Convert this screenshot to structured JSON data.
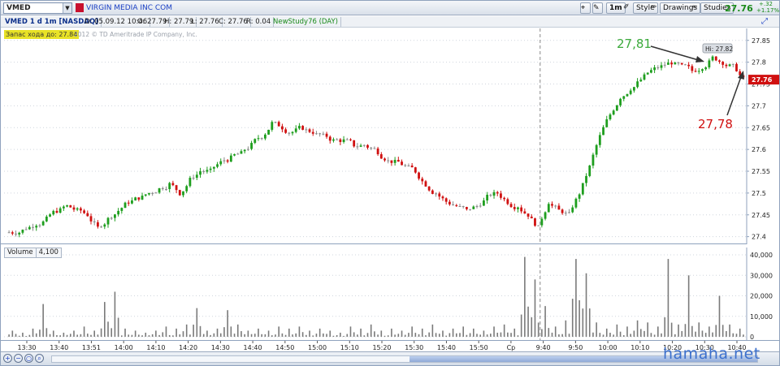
{
  "toolbar": {
    "symbol": "VMED",
    "company_name": "VIRGIN MEDIA INC COM",
    "timeframe": "1m",
    "style_label": "Style",
    "drawings_label": "Drawings",
    "studies_label": "Studies",
    "last_price": "27.76",
    "change_top": "+.32",
    "change_bottom": "+1.17%",
    "flag_color": "#c8102e"
  },
  "infobar": {
    "title": "VMED 1 d 1m [NASDAQ]",
    "date": "D: 05.09.12 10:46",
    "open": "O: 27.79",
    "high": "H: 27.79",
    "low": "L: 27.76",
    "close": "C: 27.76",
    "range": "R: 0.04",
    "study": "NewStudy76 (DAY)"
  },
  "price_pane": {
    "note": "Запас хода до: 27.84",
    "copyright": "2012 © TD Ameritrade IP Company, Inc.",
    "hi_label": "Hi: 27.82",
    "price_marker": "27.76",
    "annotation_high": "27,81",
    "annotation_low": "27,78",
    "colors": {
      "up": "#1e9e1e",
      "down": "#d01010",
      "doji": "#8a8a8a",
      "annotation_high": "#3caa3c",
      "annotation_low": "#d01010"
    }
  },
  "volume_pane": {
    "title": "Volume",
    "value": "4,100"
  },
  "time_axis": {
    "labels": [
      "13:30",
      "13:40",
      "13:51",
      "14:00",
      "14:10",
      "14:20",
      "14:30",
      "14:40",
      "14:50",
      "15:00",
      "15:10",
      "15:20",
      "15:30",
      "15:40",
      "15:50",
      "Ср",
      "9:40",
      "9:50",
      "10:00",
      "10:10",
      "10:20",
      "10:30",
      "10:40"
    ]
  },
  "watermark": "hamaha.net",
  "chart_data": {
    "type": "candlestick",
    "price_axis_ticks": [
      "27.85",
      "27.8",
      "27.75",
      "27.7",
      "27.65",
      "27.6",
      "27.55",
      "27.5",
      "27.45",
      "27.4"
    ],
    "price_ylim": [
      27.39,
      27.87
    ],
    "volume_axis_ticks": [
      "40,000",
      "30,000",
      "20,000",
      "10,000",
      "0"
    ],
    "volume_ylim": [
      0,
      42000
    ],
    "session_break": "Ср",
    "price_path": [
      27.41,
      27.42,
      27.43,
      27.44,
      27.46,
      27.47,
      27.46,
      27.45,
      27.42,
      27.44,
      27.46,
      27.48,
      27.49,
      27.5,
      27.51,
      27.52,
      27.5,
      27.53,
      27.55,
      27.55,
      27.57,
      27.58,
      27.59,
      27.61,
      27.63,
      27.66,
      27.65,
      27.64,
      27.65,
      27.64,
      27.63,
      27.62,
      27.62,
      27.61,
      27.61,
      27.6,
      27.58,
      27.57,
      27.56,
      27.55,
      27.52,
      27.5,
      27.48,
      27.47,
      27.46,
      27.47,
      27.49,
      27.5,
      27.48,
      27.47,
      27.45,
      27.42,
      27.48,
      27.46,
      27.45,
      27.5,
      27.56,
      27.63,
      27.68,
      27.72,
      27.74,
      27.76,
      27.78,
      27.79,
      27.8,
      27.79,
      27.78,
      27.79,
      27.81,
      27.8,
      27.79,
      27.76
    ],
    "volume_path": [
      3,
      2,
      4,
      16,
      3,
      2,
      3,
      5,
      3,
      17,
      22,
      4,
      3,
      2,
      3,
      5,
      4,
      6,
      14,
      3,
      4,
      13,
      6,
      3,
      4,
      3,
      5,
      4,
      5,
      3,
      4,
      3,
      2,
      5,
      4,
      6,
      3,
      4,
      3,
      5,
      4,
      6,
      3,
      4,
      5,
      4,
      3,
      5,
      6,
      4,
      39,
      28,
      15,
      5,
      8,
      38,
      31,
      7,
      4,
      6,
      5,
      8,
      7,
      5,
      38,
      6,
      30,
      7,
      5,
      20,
      6,
      4
    ]
  }
}
